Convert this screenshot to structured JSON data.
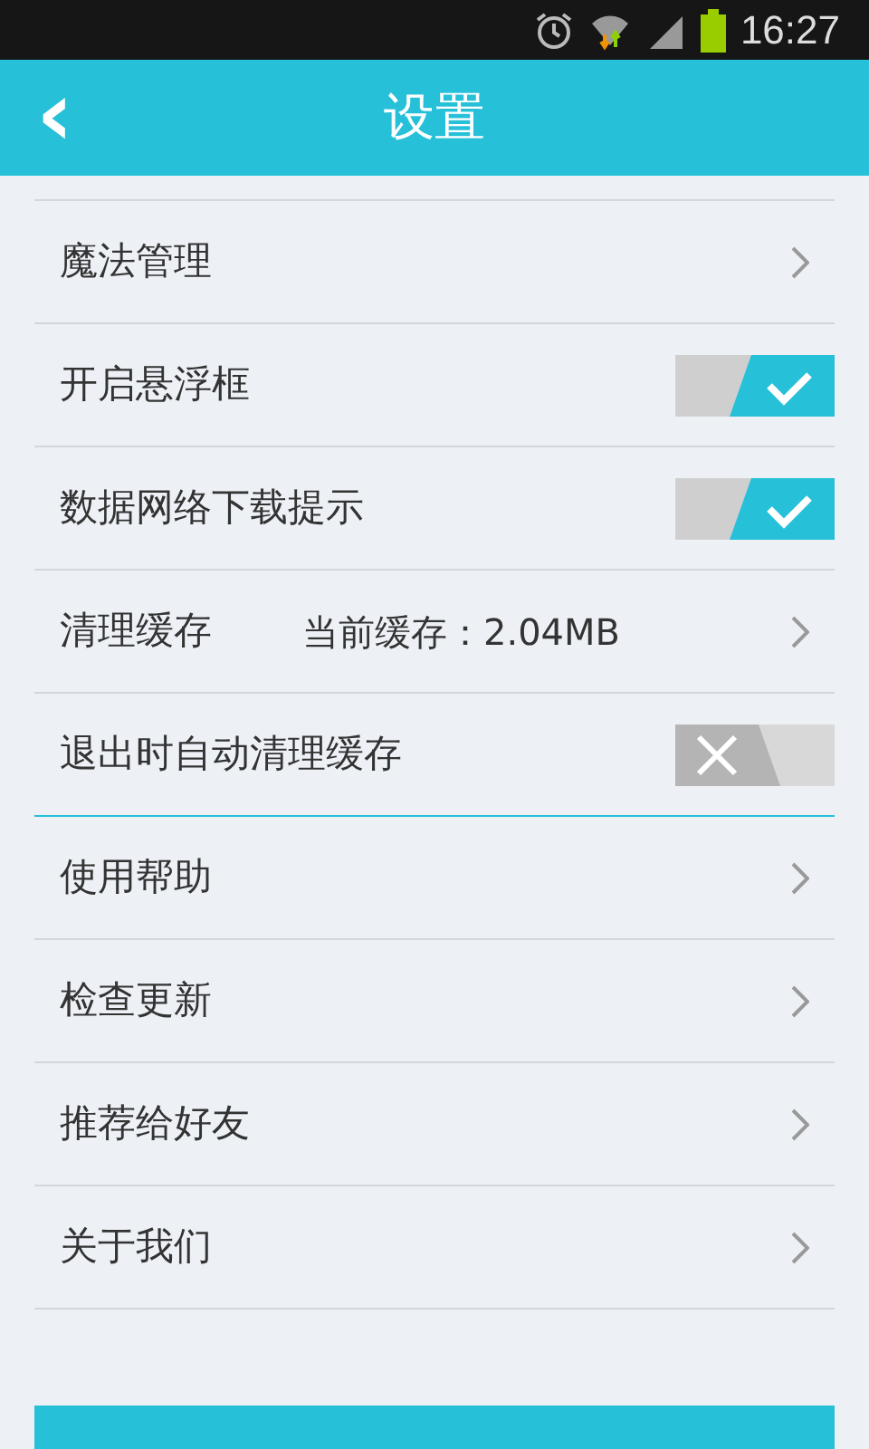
{
  "status_bar": {
    "time": "16:27"
  },
  "header": {
    "back": "‹",
    "title": "设置"
  },
  "groups": [
    {
      "rows": [
        {
          "kind": "link",
          "label": "魔法管理"
        },
        {
          "kind": "toggle",
          "label": "开启悬浮框",
          "checked": true
        },
        {
          "kind": "toggle",
          "label": "数据网络下载提示",
          "checked": true
        },
        {
          "kind": "link",
          "label": "清理缓存",
          "value": "当前缓存：2.04MB"
        },
        {
          "kind": "toggle",
          "label": "退出时自动清理缓存",
          "checked": false
        }
      ]
    },
    {
      "rows": [
        {
          "kind": "link",
          "label": "使用帮助"
        },
        {
          "kind": "link",
          "label": "检查更新"
        },
        {
          "kind": "link",
          "label": "推荐给好友"
        },
        {
          "kind": "link",
          "label": "关于我们"
        }
      ]
    }
  ],
  "bottom_button": {
    "kind": "cut"
  }
}
